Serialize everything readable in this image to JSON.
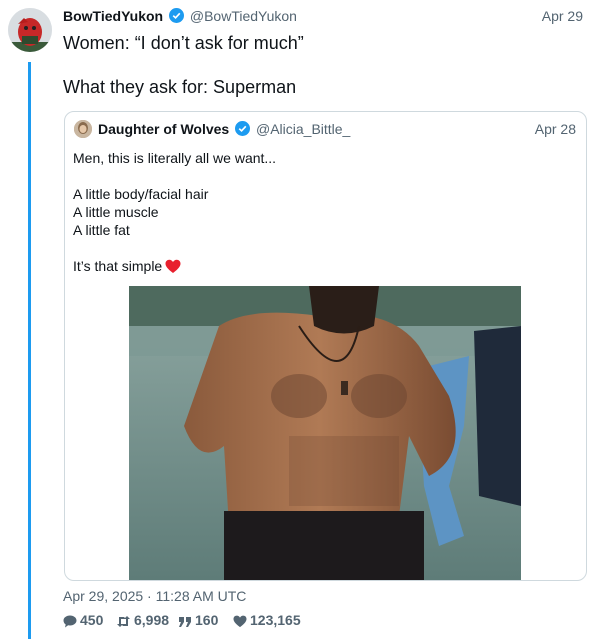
{
  "tweet": {
    "author_name": "BowTiedYukon",
    "author_handle": "@BowTiedYukon",
    "date": "Apr 29",
    "text_line1": "Women: “I don’t ask for much”",
    "text_line2": "What they ask for: Superman",
    "timestamp": "Apr 29, 2025 · 11:28 AM UTC"
  },
  "quote": {
    "author_name": "Daughter of Wolves",
    "author_handle": "@Alicia_Bittle_",
    "date": "Apr 28",
    "line1": "Men, this is literally all we want...",
    "line2": "A little body/facial hair",
    "line3": "A little muscle",
    "line4": "A little fat",
    "line5": "It’s that simple"
  },
  "stats": {
    "replies": "450",
    "retweets": "6,998",
    "quotes": "160",
    "likes": "123,165"
  },
  "colors": {
    "accent": "#1d9bf0",
    "muted_text": "#536471",
    "border": "#cfd9de",
    "heart": "#f91880"
  },
  "icons": {
    "verified": "verified-badge-icon",
    "reply": "comment-icon",
    "retweet": "retweet-icon",
    "quote": "quote-icon",
    "like": "heart-icon"
  }
}
